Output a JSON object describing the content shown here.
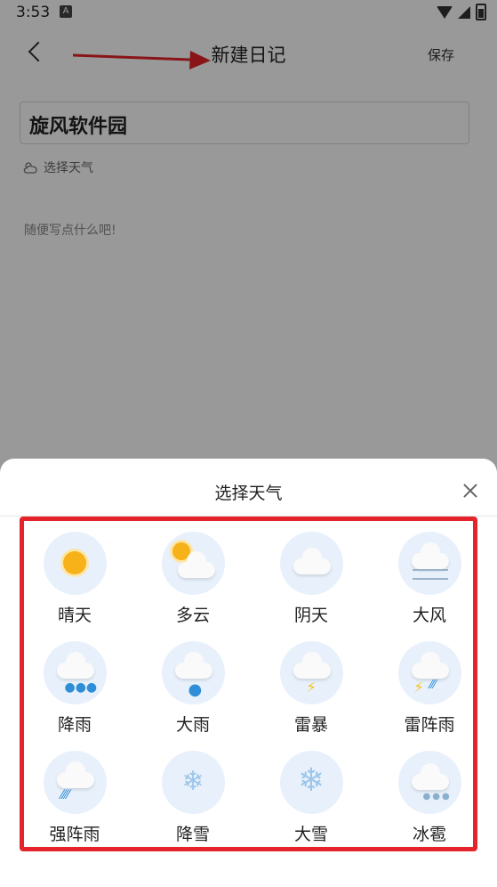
{
  "status_bar": {
    "time": "3:53",
    "badge": "A"
  },
  "header": {
    "title": "新建日记",
    "save_label": "保存"
  },
  "form": {
    "title_value": "旋风软件园",
    "weather_select_label": "选择天气",
    "body_placeholder": "随便写点什么吧!"
  },
  "sheet": {
    "title": "选择天气",
    "weather_options": [
      {
        "label": "晴天",
        "icon": "sunny-icon"
      },
      {
        "label": "多云",
        "icon": "partly-cloudy-icon"
      },
      {
        "label": "阴天",
        "icon": "overcast-icon"
      },
      {
        "label": "大风",
        "icon": "windy-icon"
      },
      {
        "label": "降雨",
        "icon": "rain-icon"
      },
      {
        "label": "大雨",
        "icon": "heavy-rain-icon"
      },
      {
        "label": "雷暴",
        "icon": "thunderstorm-icon"
      },
      {
        "label": "雷阵雨",
        "icon": "thunder-shower-icon"
      },
      {
        "label": "强阵雨",
        "icon": "heavy-shower-icon"
      },
      {
        "label": "降雪",
        "icon": "snow-icon"
      },
      {
        "label": "大雪",
        "icon": "heavy-snow-icon"
      },
      {
        "label": "冰雹",
        "icon": "hail-icon"
      }
    ]
  },
  "colors": {
    "highlight_border": "#e5232a",
    "icon_bg": "#e8f1fb",
    "arrow": "#e5232a"
  }
}
